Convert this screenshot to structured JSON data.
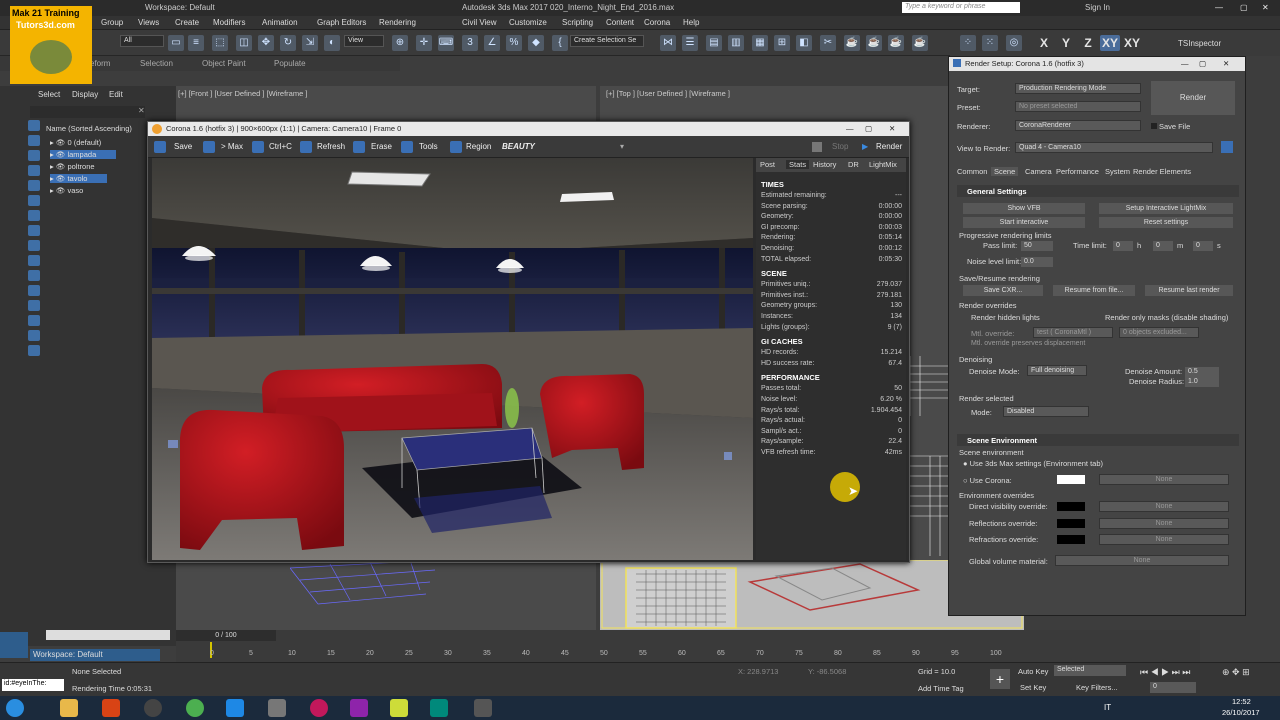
{
  "app": {
    "workspace": "Workspace: Default",
    "title": "Autodesk 3ds Max 2017    020_Interno_Night_End_2016.max",
    "search_placeholder": "Type a keyword or phrase",
    "sign_in": "Sign In",
    "logo_line1": "Mak 21 Training",
    "logo_line2": "Tutors3d.com"
  },
  "menu": [
    "Group",
    "Views",
    "Create",
    "Modifiers",
    "Animation",
    "Graph Editors",
    "Rendering",
    "Civil View",
    "Customize",
    "Scripting",
    "Content",
    "Corona",
    "Help"
  ],
  "toolbar": {
    "filter": "All",
    "view": "View",
    "selection_set": "Create Selection Se",
    "axes": [
      "X",
      "Y",
      "Z",
      "XY",
      "XY"
    ],
    "inspector": "TSInspector"
  },
  "ribbon": {
    "items": [
      "eform",
      "Selection",
      "Object Paint",
      "Populate"
    ]
  },
  "left_panel": {
    "tabs": [
      "Select",
      "Display",
      "Edit"
    ],
    "column_header": "Name (Sorted Ascending)",
    "items": [
      "0 (default)",
      "lampada",
      "poltrone",
      "tavolo",
      "vaso"
    ]
  },
  "viewports": {
    "front_label": "[+] [Front ] [User Defined ] [Wireframe ]",
    "top_label": "[+] [Top ] [User Defined ] [Wireframe ]"
  },
  "vfb": {
    "title": "Corona 1.6 (hotfix 3) | 900×600px (1:1) | Camera: Camera10 | Frame 0",
    "toolbar": [
      "Save",
      "> Max",
      "Ctrl+C",
      "Refresh",
      "Erase",
      "Tools",
      "Region"
    ],
    "channel": "BEAUTY",
    "stop": "Stop",
    "render": "Render",
    "tabs": [
      "Post",
      "Stats",
      "History",
      "DR",
      "LightMix"
    ],
    "sections": [
      {
        "title": "TIMES",
        "rows": [
          [
            "Estimated remaining:",
            "---"
          ],
          [
            "Scene parsing:",
            "0:00:00"
          ],
          [
            "Geometry:",
            "0:00:00"
          ],
          [
            "GI precomp:",
            "0:00:03"
          ],
          [
            "Rendering:",
            "0:05:14"
          ],
          [
            "Denoising:",
            "0:00:12"
          ],
          [
            "TOTAL elapsed:",
            "0:05:30"
          ]
        ]
      },
      {
        "title": "SCENE",
        "rows": [
          [
            "Primitives uniq.:",
            "279.037"
          ],
          [
            "Primitives inst.:",
            "279.181"
          ],
          [
            "Geometry groups:",
            "130"
          ],
          [
            "Instances:",
            "134"
          ],
          [
            "Lights (groups):",
            "9 (7)"
          ]
        ]
      },
      {
        "title": "GI CACHES",
        "rows": [
          [
            "HD records:",
            "15.214"
          ],
          [
            "HD success rate:",
            "67.4"
          ]
        ]
      },
      {
        "title": "PERFORMANCE",
        "rows": [
          [
            "Passes total:",
            "50"
          ],
          [
            "Noise level:",
            "6.20 %"
          ],
          [
            "Rays/s total:",
            "1.904.454"
          ],
          [
            "Rays/s actual:",
            "0"
          ],
          [
            "Sampl/s act.:",
            "0"
          ],
          [
            "Rays/sample:",
            "22.4"
          ],
          [
            "VFB refresh time:",
            "42ms"
          ]
        ]
      }
    ]
  },
  "render_setup": {
    "title": "Render Setup: Corona 1.6 (hotfix 3)",
    "target_label": "Target:",
    "target": "Production Rendering Mode",
    "preset_label": "Preset:",
    "preset": "No preset selected",
    "renderer_label": "Renderer:",
    "renderer": "CoronaRenderer",
    "save_file": "Save File",
    "view_label": "View to Render:",
    "view": "Quad 4 - Camera10",
    "render_button": "Render",
    "tabs": [
      "Common",
      "Scene",
      "Camera",
      "Performance",
      "System",
      "Render Elements"
    ],
    "general": "General Settings",
    "show_vfb": "Show VFB",
    "setup_lightmix": "Setup Interactive LightMix",
    "start_interactive": "Start interactive",
    "reset_settings": "Reset settings",
    "prog_limits": "Progressive rendering limits",
    "pass_limit_label": "Pass limit:",
    "pass_limit": "50",
    "time_limit_label": "Time limit:",
    "time_h": "0",
    "h": "h",
    "time_m": "0",
    "m": "m",
    "time_s": "0",
    "s": "s",
    "noise_label": "Noise level limit:",
    "noise": "0.0",
    "save_resume": "Save/Resume rendering",
    "save_cxr": "Save CXR...",
    "resume_file": "Resume from file...",
    "resume_last": "Resume last render",
    "overrides": "Render overrides",
    "hidden_lights": "Render hidden lights",
    "only_masks": "Render only masks (disable shading)",
    "mtl_override": "Mtl. override:",
    "mtl_value": "test  ( CoronaMtl )",
    "objects_excluded": "0 objects excluded...",
    "mtl_preserve": "Mtl. override preserves displacement",
    "denoising": "Denoising",
    "denoise_mode_label": "Denoise Mode:",
    "denoise_mode": "Full denoising",
    "denoise_amount_label": "Denoise Amount:",
    "denoise_amount": "0.5",
    "denoise_radius_label": "Denoise Radius:",
    "denoise_radius": "1.0",
    "render_selected": "Render selected",
    "mode_label": "Mode:",
    "mode": "Disabled",
    "scene_env": "Scene Environment",
    "scene_env_sub": "Scene environment",
    "use_3ds": "Use 3ds Max settings (Environment tab)",
    "use_corona": "Use Corona:",
    "none": "None",
    "env_overrides": "Environment overrides",
    "direct_vis": "Direct visibility override:",
    "reflections": "Reflections override:",
    "refractions": "Refractions override:",
    "global_volume": "Global volume material:"
  },
  "timeline": {
    "frame": "0 / 100",
    "ticks": [
      "0",
      "5",
      "10",
      "15",
      "20",
      "25",
      "30",
      "35",
      "40",
      "45",
      "50",
      "55",
      "60",
      "65",
      "70",
      "75",
      "80",
      "85",
      "90",
      "95",
      "100"
    ]
  },
  "status": {
    "workspace": "Workspace: Default",
    "none_selected": "None Selected",
    "render_time": "Rendering Time  0:05:31",
    "maxscript": "id:#eyeInThe:",
    "x": "X: 228.9713",
    "y": "Y: -86.5068",
    "grid": "Grid = 10.0",
    "add_time_tag": "Add Time Tag",
    "auto_key": "Auto Key",
    "selected": "Selected",
    "set_key": "Set Key",
    "key_filters": "Key Filters...",
    "frame_field": "0",
    "clock": "12:52",
    "date": "26/10/2017",
    "lang": "IT"
  },
  "colors": {
    "accent": "#3a6fb5",
    "sofa_red": "#b3121a",
    "bg": "#3d3d3d"
  }
}
